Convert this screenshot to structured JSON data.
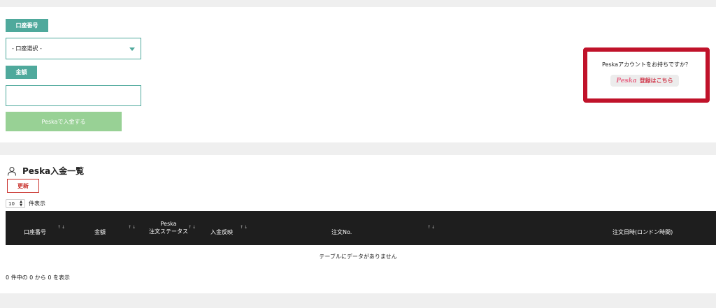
{
  "form": {
    "account_label": "口座番号",
    "account_select_value": "- 口座選択 -",
    "amount_label": "金額",
    "amount_value": "",
    "deposit_button": "Peskaで入金する"
  },
  "promo": {
    "question": "Peskaアカウントをお持ちですか？",
    "logo": "Peska",
    "register_label": "登録はこちら"
  },
  "list": {
    "title": "Peska入金一覧",
    "refresh_button": "更新",
    "page_length": "10",
    "page_length_suffix": "件表示",
    "columns": [
      "口座番号",
      "金額",
      "Peska",
      "注文ステータス",
      "入金反映",
      "注文No.",
      "注文日時(ロンドン時間)"
    ],
    "empty_message": "テーブルにデータがありません",
    "info": "0 件中の 0 から 0 を表示"
  },
  "icons": {
    "user": "user-icon",
    "dropdown": "chevron-down-icon",
    "sort": "sort-icon"
  },
  "colors": {
    "accent": "#4fa99c",
    "deposit_button": "#98d195",
    "promo_border": "#c0122a",
    "refresh": "#c9322d",
    "table_header": "#1e1e1e"
  }
}
